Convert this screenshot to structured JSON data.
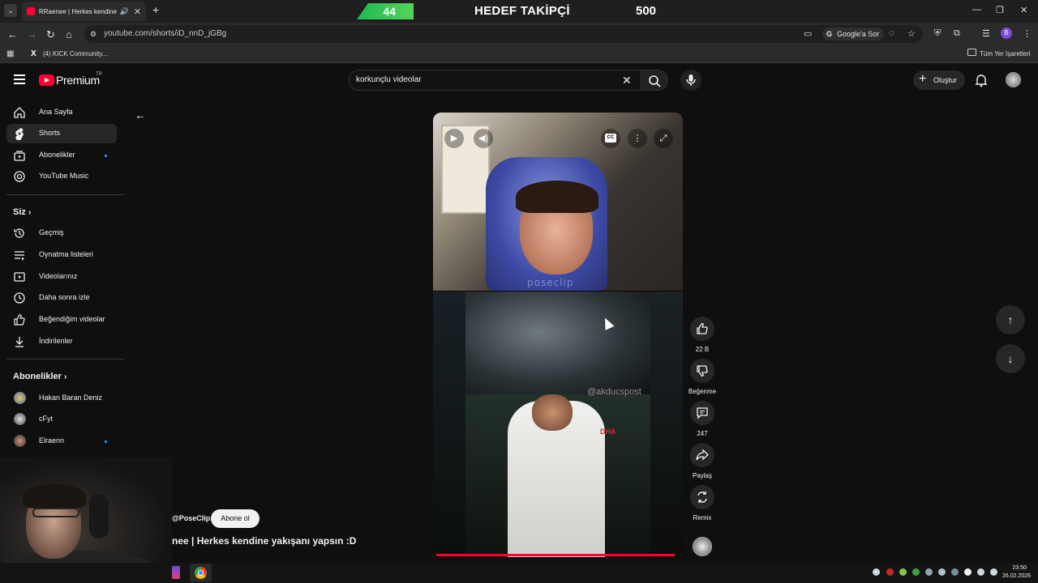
{
  "browser": {
    "tab_title": "RRaenee | Herkes kendine yakışanı yapsın :D - YouTube",
    "url": "youtube.com/shorts/iD_nnD_jGBg",
    "google_ask": "Google'a Sor",
    "profile_initial": "B",
    "bookmark_1": "(4) KICK Community...",
    "all_bookmarks": "Tüm Yer İşaretleri"
  },
  "overlay": {
    "follower_count": "44",
    "goal_label": "HEDEF TAKİPÇİ",
    "goal_target": "500"
  },
  "header": {
    "logo_text": "Premium",
    "logo_region": "TR",
    "search_query": "korkunçlu videolar",
    "create_label": "Oluştur"
  },
  "sidebar": {
    "main": [
      {
        "label": "Ana Sayfa",
        "icon": "home-icon"
      },
      {
        "label": "Shorts",
        "icon": "shorts-icon"
      },
      {
        "label": "Abonelikler",
        "icon": "subscriptions-icon"
      },
      {
        "label": "YouTube Music",
        "icon": "music-icon"
      }
    ],
    "you_header": "Siz",
    "you": [
      {
        "label": "Geçmiş",
        "icon": "history-icon"
      },
      {
        "label": "Oynatma listeleri",
        "icon": "playlists-icon"
      },
      {
        "label": "Videolarınız",
        "icon": "your-videos-icon"
      },
      {
        "label": "Daha sonra izle",
        "icon": "watch-later-icon"
      },
      {
        "label": "Beğendiğim videolar",
        "icon": "liked-icon"
      },
      {
        "label": "İndirilenler",
        "icon": "downloads-icon"
      }
    ],
    "subs_header": "Abonelikler",
    "subs": [
      {
        "label": "Hakan Baran Deniz"
      },
      {
        "label": "cFyt"
      },
      {
        "label": "Elraenn"
      }
    ]
  },
  "short": {
    "watermark_top": "poseclip",
    "watermark_bottom": "@akducspost",
    "news_logo": "DHA",
    "channel_handle": "@PoseClip",
    "subscribe_label": "Abone ol",
    "title": "nee | Herkes kendine yakışanı yapsın :D",
    "progress": 0.98
  },
  "actions": {
    "likes": "22 B",
    "dislike": "Beğenme",
    "comments": "247",
    "share": "Paylaş",
    "remix": "Remix"
  },
  "taskbar": {
    "time": "23:50",
    "date": "26.02.2026"
  }
}
